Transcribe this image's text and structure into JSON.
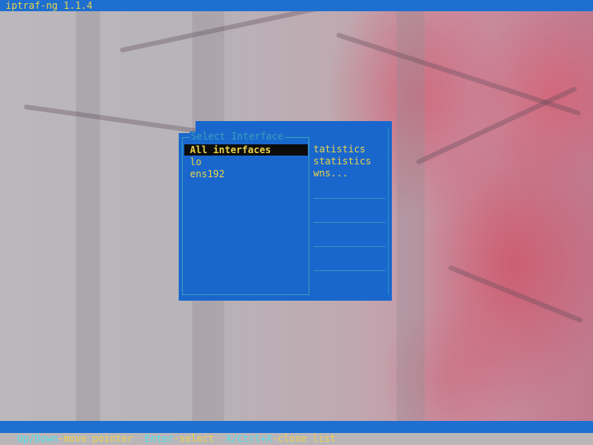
{
  "app": {
    "title": "iptraf-ng 1.1.4"
  },
  "dialog": {
    "title": "Select Interface",
    "items": [
      "All interfaces",
      "lo",
      "ens192"
    ],
    "selected_index": 0
  },
  "background_menu": {
    "visible_labels": [
      "tatistics",
      "statistics",
      "wns..."
    ]
  },
  "statusbar": {
    "hint1_key": "Up/Down",
    "hint1_desc": "-move pointer",
    "hint2_key": "Enter",
    "hint2_desc": "-select",
    "hint3_key": "X/Ctrl+X",
    "hint3_desc": "-close list"
  },
  "colors": {
    "bar_blue": "#1e6fd0",
    "panel_blue": "#1967cd",
    "text_yellow": "#e9d24a",
    "key_cyan": "#4fe1e8",
    "border_teal": "#3aa0b8"
  }
}
